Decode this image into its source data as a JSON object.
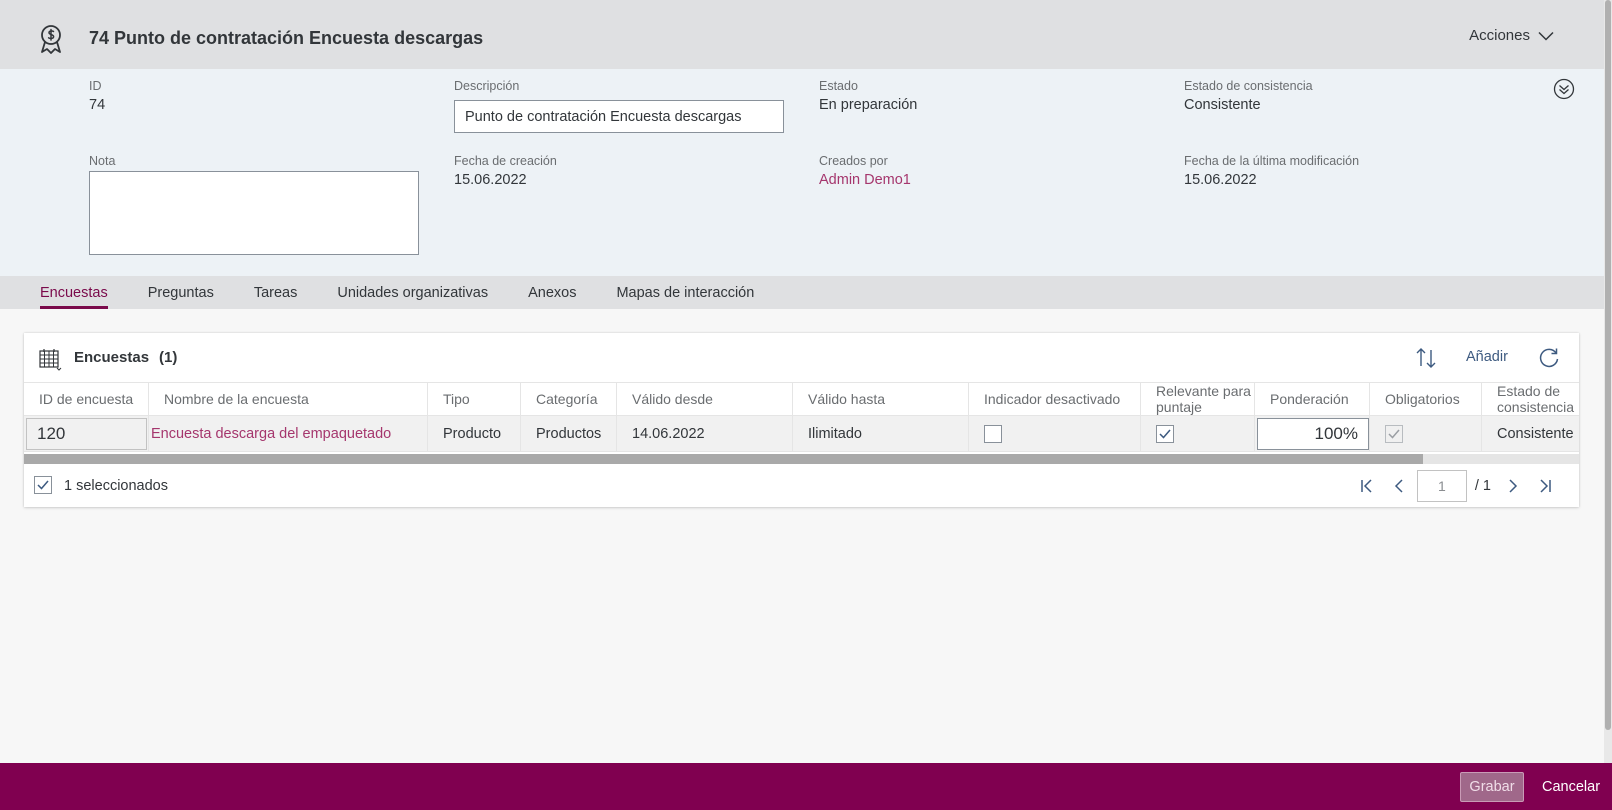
{
  "header": {
    "title": "74 Punto de contratación Encuesta descargas",
    "actions_label": "Acciones",
    "icon": "award-dollar-icon"
  },
  "attributes": {
    "id_label": "ID",
    "id_value": "74",
    "descripcion_label": "Descripción",
    "descripcion_value": "Punto de contratación Encuesta descargas",
    "estado_label": "Estado",
    "estado_value": "En preparación",
    "consistencia_label": "Estado de consistencia",
    "consistencia_value": "Consistente",
    "nota_label": "Nota",
    "nota_value": "",
    "fecha_creacion_label": "Fecha de creación",
    "fecha_creacion_value": "15.06.2022",
    "creados_por_label": "Creados por",
    "creados_por_value": "Admin Demo1",
    "fecha_modif_label": "Fecha de la última modificación",
    "fecha_modif_value": "15.06.2022"
  },
  "tabs": [
    {
      "label": "Encuestas",
      "active": true
    },
    {
      "label": "Preguntas",
      "active": false
    },
    {
      "label": "Tareas",
      "active": false
    },
    {
      "label": "Unidades organizativas",
      "active": false
    },
    {
      "label": "Anexos",
      "active": false
    },
    {
      "label": "Mapas de interacción",
      "active": false
    }
  ],
  "table": {
    "title": "Encuestas",
    "count": "(1)",
    "add_label": "Añadir",
    "columns": [
      "ID de encuesta",
      "Nombre de la encuesta",
      "Tipo",
      "Categoría",
      "Válido desde",
      "Válido hasta",
      "Indicador desactivado",
      "Relevante para puntaje",
      "Ponderación",
      "Obligatorios",
      "Estado de consistencia"
    ],
    "rows": [
      {
        "id": "120",
        "nombre": "Encuesta descarga del empaquetado",
        "tipo": "Producto",
        "categoria": "Productos",
        "valido_desde": "14.06.2022",
        "valido_hasta": "Ilimitado",
        "indicador_desactivado": false,
        "relevante": true,
        "ponderacion": "100%",
        "obligatorios": true,
        "estado": "Consistente"
      }
    ],
    "selected_text": "1 seleccionados",
    "pager": {
      "current": "1",
      "total": "/ 1"
    }
  },
  "footer": {
    "save_label": "Grabar",
    "cancel_label": "Cancelar"
  },
  "colors": {
    "brand": "#800050",
    "link": "#a5366d",
    "tab_active": "#7a0a4b"
  }
}
